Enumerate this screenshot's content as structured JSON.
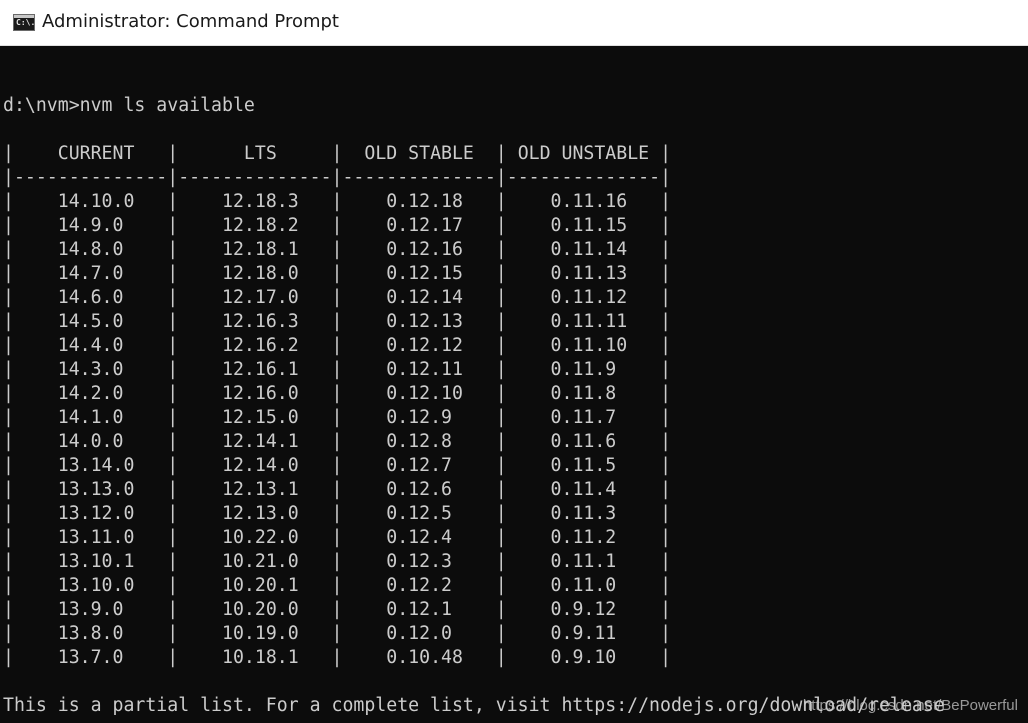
{
  "window": {
    "title": "Administrator: Command Prompt",
    "icon": "cmd-icon",
    "icon_glyph": "C:\\."
  },
  "console": {
    "command_line": "d:\\nvm>nvm ls available",
    "table": {
      "headers": [
        "CURRENT",
        "LTS",
        "OLD STABLE",
        "OLD UNSTABLE"
      ],
      "rows": [
        [
          "14.10.0",
          "12.18.3",
          "0.12.18",
          "0.11.16"
        ],
        [
          "14.9.0",
          "12.18.2",
          "0.12.17",
          "0.11.15"
        ],
        [
          "14.8.0",
          "12.18.1",
          "0.12.16",
          "0.11.14"
        ],
        [
          "14.7.0",
          "12.18.0",
          "0.12.15",
          "0.11.13"
        ],
        [
          "14.6.0",
          "12.17.0",
          "0.12.14",
          "0.11.12"
        ],
        [
          "14.5.0",
          "12.16.3",
          "0.12.13",
          "0.11.11"
        ],
        [
          "14.4.0",
          "12.16.2",
          "0.12.12",
          "0.11.10"
        ],
        [
          "14.3.0",
          "12.16.1",
          "0.12.11",
          "0.11.9"
        ],
        [
          "14.2.0",
          "12.16.0",
          "0.12.10",
          "0.11.8"
        ],
        [
          "14.1.0",
          "12.15.0",
          "0.12.9",
          "0.11.7"
        ],
        [
          "14.0.0",
          "12.14.1",
          "0.12.8",
          "0.11.6"
        ],
        [
          "13.14.0",
          "12.14.0",
          "0.12.7",
          "0.11.5"
        ],
        [
          "13.13.0",
          "12.13.1",
          "0.12.6",
          "0.11.4"
        ],
        [
          "13.12.0",
          "12.13.0",
          "0.12.5",
          "0.11.3"
        ],
        [
          "13.11.0",
          "10.22.0",
          "0.12.4",
          "0.11.2"
        ],
        [
          "13.10.1",
          "10.21.0",
          "0.12.3",
          "0.11.1"
        ],
        [
          "13.10.0",
          "10.20.1",
          "0.12.2",
          "0.11.0"
        ],
        [
          "13.9.0",
          "10.20.0",
          "0.12.1",
          "0.9.12"
        ],
        [
          "13.8.0",
          "10.19.0",
          "0.12.0",
          "0.9.11"
        ],
        [
          "13.7.0",
          "10.18.1",
          "0.10.48",
          "0.9.10"
        ]
      ]
    },
    "footer_line": "This is a partial list. For a complete list, visit https://nodejs.org/download/release"
  },
  "watermark": "https://blog.csdn.net/BePowerful",
  "colors": {
    "console_bg": "#0c0c0c",
    "console_fg": "#cccccc",
    "titlebar_bg": "#ffffff"
  }
}
